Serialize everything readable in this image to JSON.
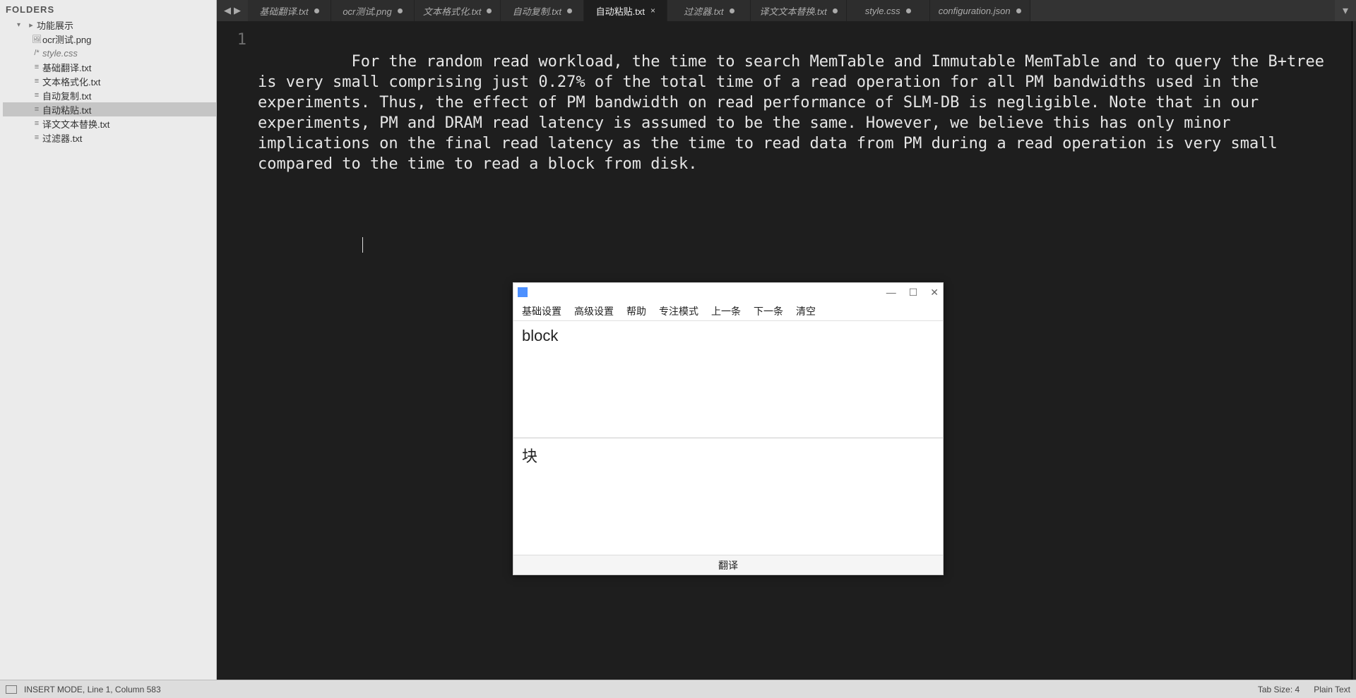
{
  "sidebar": {
    "header": "FOLDERS",
    "root": "功能展示",
    "files": [
      {
        "icon": "img",
        "label": "ocr测试.png",
        "selected": false
      },
      {
        "icon": "css",
        "label": "style.css",
        "selected": false,
        "italic": true
      },
      {
        "icon": "txt",
        "label": "基础翻译.txt",
        "selected": false
      },
      {
        "icon": "txt",
        "label": "文本格式化.txt",
        "selected": false
      },
      {
        "icon": "txt",
        "label": "自动复制.txt",
        "selected": false
      },
      {
        "icon": "txt",
        "label": "自动粘贴.txt",
        "selected": true
      },
      {
        "icon": "txt",
        "label": "译文文本替换.txt",
        "selected": false
      },
      {
        "icon": "txt",
        "label": "过滤器.txt",
        "selected": false
      }
    ]
  },
  "tabs": [
    {
      "label": "基础翻译.txt",
      "modified": true,
      "active": false,
      "italic": true
    },
    {
      "label": "ocr测试.png",
      "modified": true,
      "active": false,
      "italic": true
    },
    {
      "label": "文本格式化.txt",
      "modified": true,
      "active": false,
      "italic": true
    },
    {
      "label": "自动复制.txt",
      "modified": true,
      "active": false,
      "italic": true
    },
    {
      "label": "自动粘贴.txt",
      "modified": false,
      "active": true,
      "italic": false
    },
    {
      "label": "过滤器.txt",
      "modified": true,
      "active": false,
      "italic": true
    },
    {
      "label": "译文文本替换.txt",
      "modified": true,
      "active": false,
      "italic": true
    },
    {
      "label": "style.css",
      "modified": true,
      "active": false,
      "italic": true
    },
    {
      "label": "configuration.json",
      "modified": true,
      "active": false,
      "italic": true
    }
  ],
  "editor": {
    "line_number": "1",
    "content": "For the random read workload, the time to search MemTable and Immutable MemTable and to query the B+tree is very small comprising just 0.27% of the total time of a read operation for all PM bandwidths used in the experiments. Thus, the effect of PM bandwidth on read performance of SLM-DB is negligible. Note that in our experiments, PM and DRAM read latency is assumed to be the same. However, we believe this has only minor implications on the final read latency as the time to read data from PM during a read operation is very small compared to the time to read a block from disk."
  },
  "overlay": {
    "menu": [
      "基础设置",
      "高级设置",
      "帮助",
      "专注模式",
      "上一条",
      "下一条",
      "清空"
    ],
    "source_text": "block",
    "target_text": "块",
    "footer": "翻译",
    "win_btns": {
      "min": "—",
      "max": "☐",
      "close": "✕"
    }
  },
  "status": {
    "left": "INSERT MODE, Line 1, Column 583",
    "tab_size": "Tab Size: 4",
    "syntax": "Plain Text"
  },
  "icons": {
    "folder_arrow": "▾",
    "folder": "▸",
    "img": "🖼",
    "css": "/*",
    "txt": "≡",
    "nav_back": "◀",
    "nav_fwd": "▶",
    "tab_close": "×",
    "more": "▾"
  }
}
